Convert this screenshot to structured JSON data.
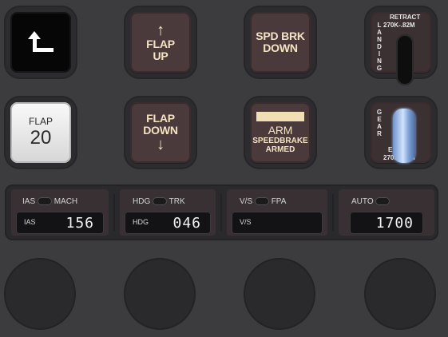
{
  "buttons": {
    "back": {
      "icon": "return-arrow-icon"
    },
    "flap_up": {
      "arrow": "↑",
      "line1": "FLAP",
      "line2": "UP"
    },
    "spd_brk_down": {
      "line1": "SPD BRK",
      "line2": "DOWN"
    },
    "flap_20": {
      "line1": "FLAP",
      "line2": "20"
    },
    "flap_down": {
      "line1": "FLAP",
      "line2": "DOWN",
      "arrow": "↓"
    },
    "speedbrake_armed": {
      "line1": "ARM",
      "line2": "SPEEDBRAKE",
      "line3": "ARMED"
    }
  },
  "landing_gear": {
    "top_label": "RETRACT",
    "top_speed": "270K-.82M",
    "bottom_label": "EXTEND",
    "bottom_speed": "270K-.82M",
    "vertical_landing": "L\nA\nN\nD\nI\nN\nG",
    "vertical_gear": "G\nE\nA\nR",
    "handle_position": "down"
  },
  "autopilot": {
    "speed": {
      "label_left": "IAS",
      "label_right": "MACH",
      "display_label": "IAS",
      "value": "156"
    },
    "heading": {
      "label_left": "HDG",
      "label_right": "TRK",
      "display_label": "HDG",
      "value": "046"
    },
    "vertical": {
      "label_left": "V/S",
      "label_right": "FPA",
      "display_label": "V/S",
      "value": ""
    },
    "altitude": {
      "label_left": "AUTO",
      "display_label": "",
      "value": "1700"
    }
  },
  "colors": {
    "key_face": "#4a3a3c",
    "legend": "#f3e3c2",
    "panel": "#3c3c3e",
    "gear_handle": "#a9c5f2"
  }
}
